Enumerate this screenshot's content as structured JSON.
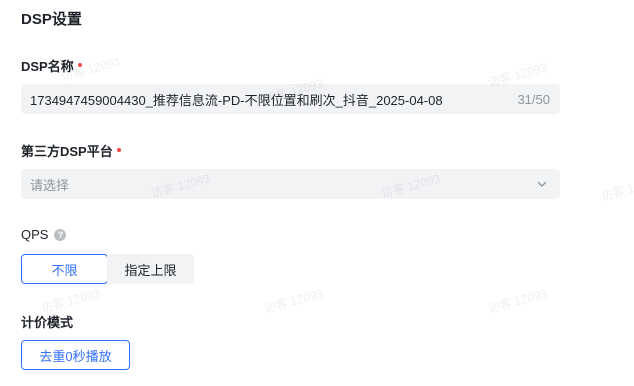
{
  "section": {
    "title": "DSP设置"
  },
  "dsp_name": {
    "label": "DSP名称",
    "value": "1734947459004430_推荐信息流-PD-不限位置和刷次_抖音_2025-04-08",
    "counter": "31/50"
  },
  "third_party": {
    "label": "第三方DSP平台",
    "placeholder": "请选择",
    "chevron_icon": "chevron-down-icon"
  },
  "qps": {
    "label": "QPS",
    "help_icon": "question-circle-icon",
    "options": [
      "不限",
      "指定上限"
    ],
    "selected": "不限"
  },
  "pricing": {
    "label": "计价模式",
    "option": "去重0秒播放"
  },
  "watermark": {
    "text": "访客 12093"
  },
  "colors": {
    "accent": "#3370ff",
    "required": "#f54a45",
    "field_bg": "#f2f3f5",
    "muted_text": "#8f959e"
  }
}
